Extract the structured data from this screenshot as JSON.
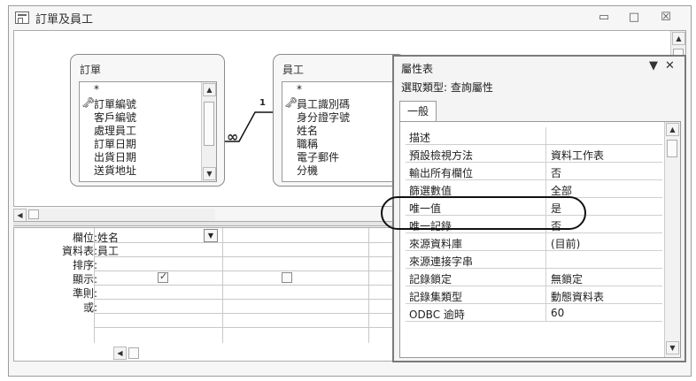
{
  "window": {
    "title": "訂單及員工"
  },
  "tables": [
    {
      "title": "訂單",
      "star": "*",
      "fields": [
        "訂單編號",
        "客戶編號",
        "處理員工",
        "訂單日期",
        "出貨日期",
        "送貨地址"
      ]
    },
    {
      "title": "員工",
      "star": "*",
      "fields": [
        "員工識別碼",
        "身分證字號",
        "姓名",
        "職稱",
        "電子郵件",
        "分機"
      ]
    }
  ],
  "relationship": {
    "one": "1",
    "many": "∞"
  },
  "grid": {
    "labels": [
      "欄位:",
      "資料表:",
      "排序:",
      "顯示:",
      "準則:",
      "或:"
    ],
    "col1_field": "姓名",
    "col1_table": "員工"
  },
  "property_sheet": {
    "title": "屬性表",
    "selection": "選取類型:  查詢屬性",
    "tab": "一般",
    "rows": [
      {
        "name": "描述",
        "value": ""
      },
      {
        "name": "預設檢視方法",
        "value": "資料工作表"
      },
      {
        "name": "輸出所有欄位",
        "value": "否"
      },
      {
        "name": "篩選數值",
        "value": "全部"
      },
      {
        "name": "唯一值",
        "value": "是"
      },
      {
        "name": "唯一記錄",
        "value": "否"
      },
      {
        "name": "來源資料庫",
        "value": "(目前)"
      },
      {
        "name": "來源連接字串",
        "value": ""
      },
      {
        "name": "記錄鎖定",
        "value": "無鎖定"
      },
      {
        "name": "記錄集類型",
        "value": "動態資料表"
      },
      {
        "name": "ODBC 逾時",
        "value": "60"
      }
    ]
  },
  "controls": {
    "minimize": "▭",
    "maximize": "□",
    "close": "☒",
    "sheet_menu": "▼",
    "sheet_close": "✕"
  }
}
